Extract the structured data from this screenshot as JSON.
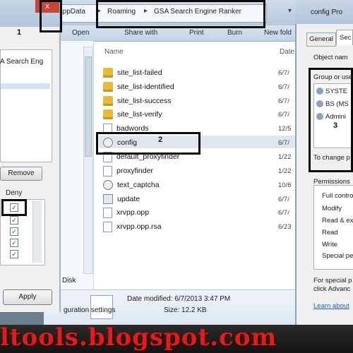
{
  "explorer": {
    "breadcrumb": [
      "AppData",
      "Roaming",
      "GSA Search Engine Ranker"
    ],
    "toolbar": [
      "Open",
      "Share with",
      "Print",
      "Burn",
      "New fold"
    ],
    "columns": {
      "name": "Name",
      "date": "Date"
    },
    "files": [
      {
        "name": "site_list-failed",
        "date": "6/7/",
        "icon": "folder-icon"
      },
      {
        "name": "site_list-identified",
        "date": "6/7/",
        "icon": "folder-icon"
      },
      {
        "name": "site_list-success",
        "date": "6/7/",
        "icon": "folder-icon"
      },
      {
        "name": "site_list-verify",
        "date": "6/7/",
        "icon": "folder-icon"
      },
      {
        "name": "badwords",
        "date": "12/5",
        "icon": "file-icon"
      },
      {
        "name": "config",
        "date": "6/7/",
        "icon": "config-file-icon"
      },
      {
        "name": "default_proxyfinder",
        "date": "1/22",
        "icon": "file-icon"
      },
      {
        "name": "proxyfinder",
        "date": "1/22",
        "icon": "file-icon"
      },
      {
        "name": "text_captcha",
        "date": "10/6",
        "icon": "gear-icon"
      },
      {
        "name": "update",
        "date": "6/7/",
        "icon": "exe-icon"
      },
      {
        "name": "xrvpp.opp",
        "date": "6/7/",
        "icon": "file-icon"
      },
      {
        "name": "xrvpp.opp.rsa",
        "date": "6/23",
        "icon": "file-icon"
      }
    ],
    "details": {
      "modified": "Date modified: 6/7/2013 3:47 PM",
      "size": "Size: 12.2 KB",
      "type_partial": "guration settings"
    },
    "nav_partial": "Disk"
  },
  "left_dialog": {
    "close_label": "x",
    "list_item_partial": "A Search Eng",
    "remove_label": "Remove",
    "deny_label": "Deny",
    "apply_label": "Apply",
    "checkbox_glyph": "✓"
  },
  "right_dialog": {
    "title_partial": "config Pro",
    "tab_general": "General",
    "tab_security": "Sec",
    "object_name": "Object nam",
    "group_label": "Group or use",
    "users": [
      "SYSTE",
      "BS (MS",
      "Admini"
    ],
    "change_text": "To change p",
    "permissions_label": "Permissions",
    "permissions": [
      "Full contro",
      "Modify",
      "Read & ex",
      "Read",
      "Write",
      "Special pe"
    ],
    "special_text": [
      "For special p",
      "click Advanc"
    ],
    "learn_link": "Learn about"
  },
  "annotations": {
    "n1": "1",
    "n2": "2",
    "n3": "3"
  },
  "watermark": "ltools.blogspot.com",
  "colors": {
    "annotation": "#0a0a0a",
    "watermark": "#e21b1b",
    "close": "#c9453a"
  }
}
